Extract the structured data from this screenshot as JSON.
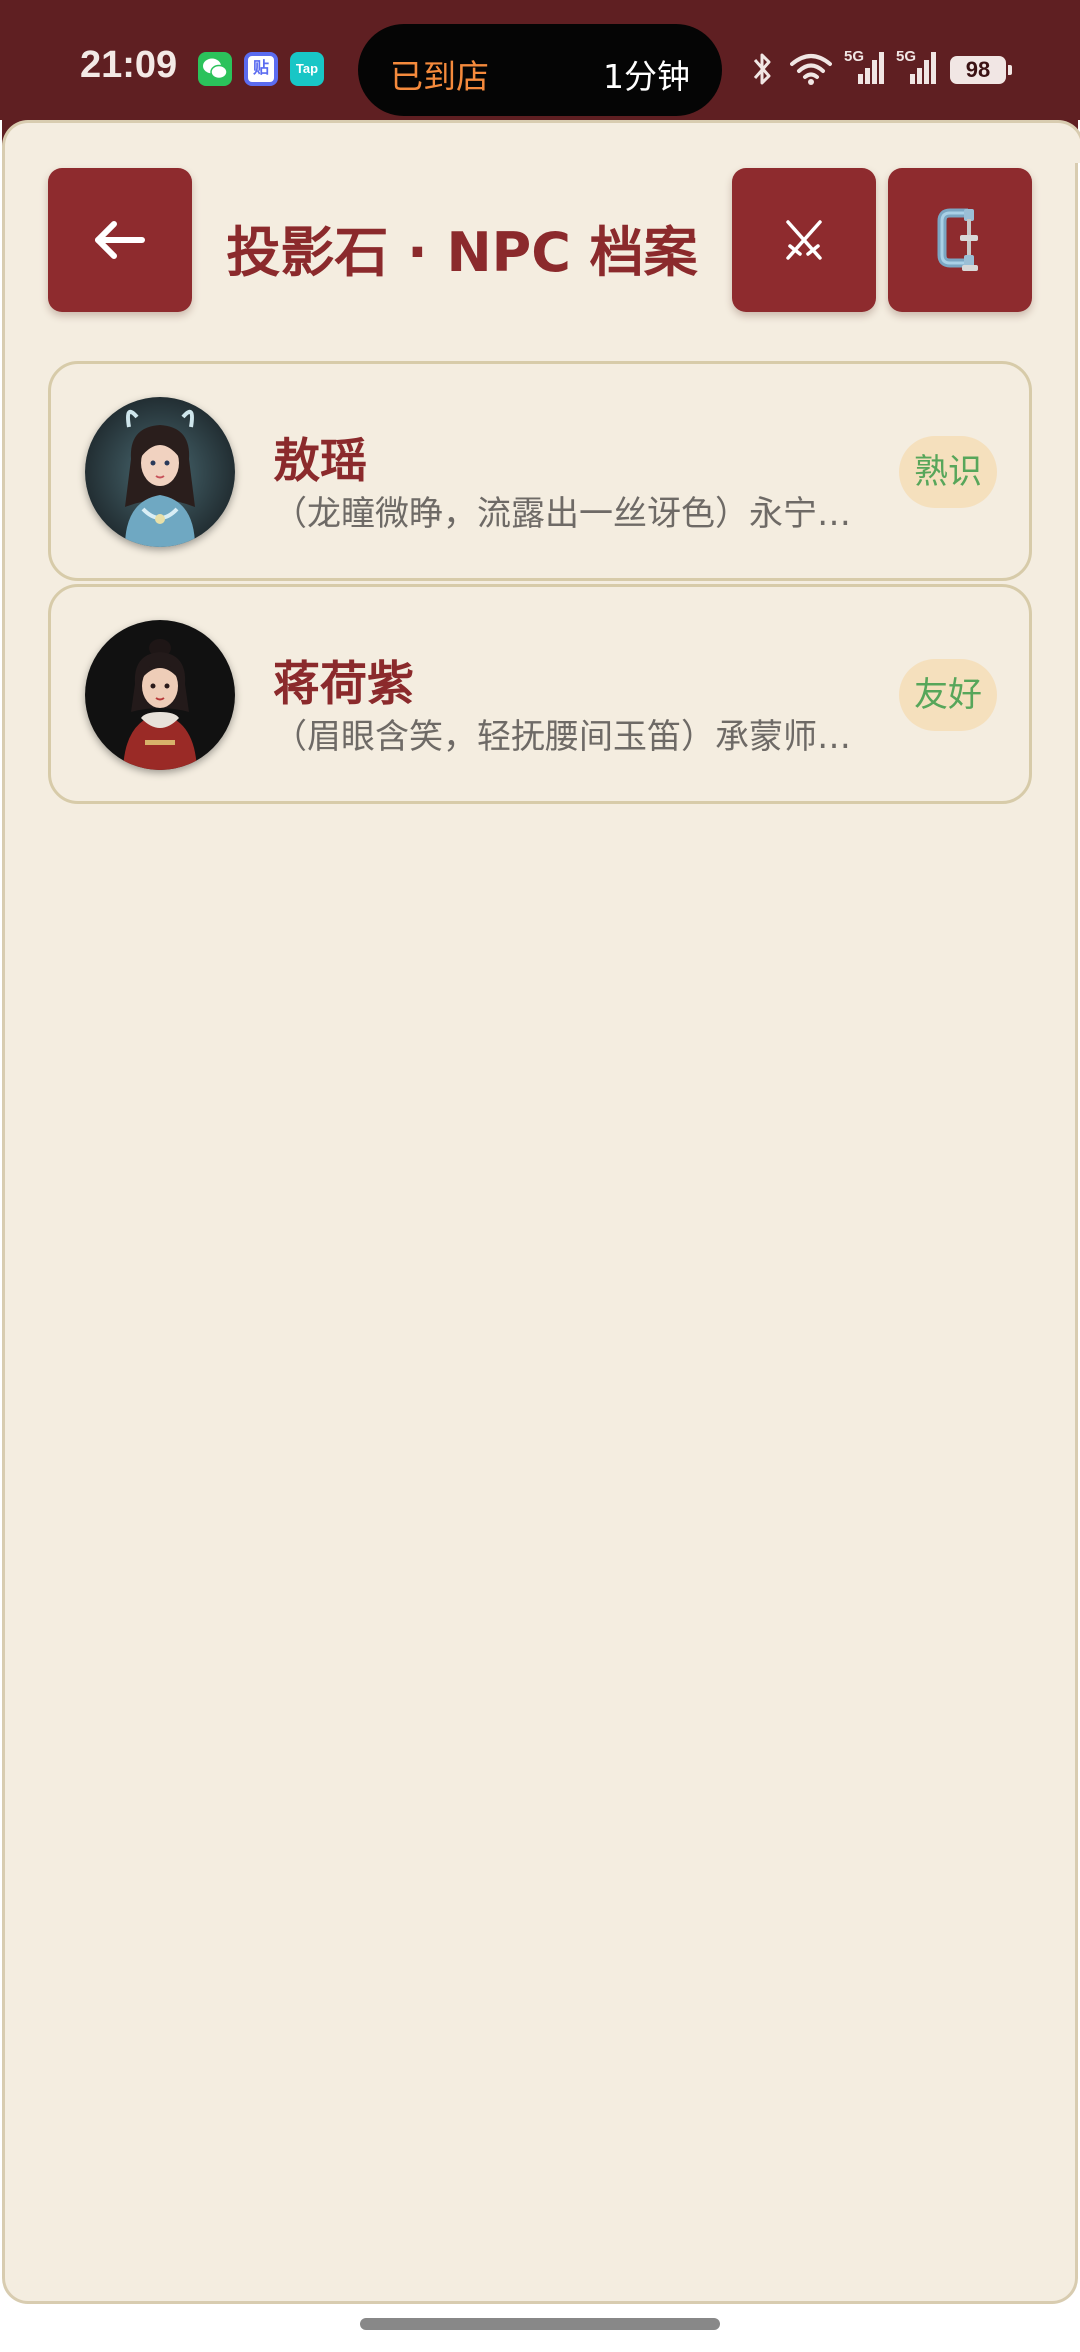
{
  "status_bar": {
    "time": "21:09",
    "app_icons": [
      {
        "name": "wechat-icon",
        "label": "",
        "color": "#2bc25b"
      },
      {
        "name": "tieba-icon",
        "label": "贴",
        "color": "#5b6cf0"
      },
      {
        "name": "taptap-icon",
        "label": "Tap",
        "color": "#18c6c6"
      }
    ],
    "pill": {
      "left_text": "已到店",
      "right_text": "1分钟"
    },
    "network_labels": [
      "5G",
      "5G"
    ],
    "battery": "98"
  },
  "header": {
    "back_icon": "arrow-left-icon",
    "title": "投影石 · NPC 档案",
    "battle_icon": "crossed-swords-icon",
    "clamp_icon": "clamp-icon"
  },
  "npcs": [
    {
      "name": "敖瑶",
      "description": "（龙瞳微睁，流露出一丝讶色）永宁…",
      "relation": "熟识"
    },
    {
      "name": "蒋荷紫",
      "description": "（眉眼含笑，轻抚腰间玉笛）承蒙师…",
      "relation": "友好"
    }
  ],
  "colors": {
    "status_bar": "#5f1f22",
    "accent": "#8e2b2e",
    "background": "#f4ede0",
    "card_border": "#d7cba9",
    "badge_bg": "#f5e0bd",
    "badge_text": "#57a65a"
  }
}
